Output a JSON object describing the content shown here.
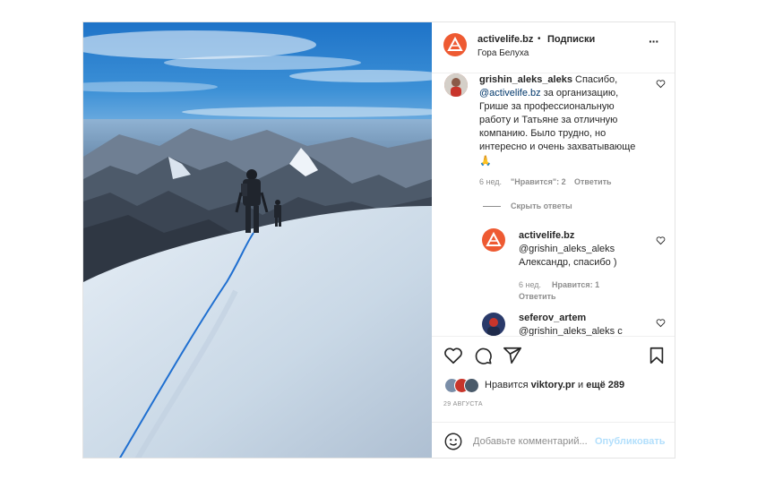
{
  "post": {
    "author": "activelife.bz",
    "dot": "•",
    "follow_label": "Подписки",
    "location": "Гора Белуха",
    "more_label": "···"
  },
  "comments": [
    {
      "user": "grishin_aleks_aleks",
      "text_part1": "Спасибо,",
      "mention": "@activelife.bz",
      "text_part2_line1": " за организацию,",
      "text_lines": [
        "Грише за профессиональную",
        "работу и Татьяне за отличную",
        "компанию. Было трудно, но",
        "интересно и очень захватывающе"
      ],
      "emoji": "🙏",
      "time": "6 нед.",
      "likes": "\"Нравится\": 2",
      "reply_label": "Ответить"
    }
  ],
  "hide_replies_label": "Скрыть ответы",
  "replies": [
    {
      "user": "activelife.bz",
      "mention": "@grishin_aleks_aleks",
      "text": "Александр, спасибо )",
      "time": "6 нед.",
      "likes": "Нравится: 1",
      "reply_label": "Ответить"
    },
    {
      "user": "seferov_artem",
      "mention": "@grishin_aleks_aleks с"
    }
  ],
  "likes_line": {
    "prefix": "Нравится",
    "user": "viktory.pr",
    "conj": "и",
    "others": "ещё 289"
  },
  "date": "29 АВГУСТА",
  "composer": {
    "placeholder": "Добавьте комментарий...",
    "publish_label": "Опубликовать"
  },
  "colors": {
    "brand": "#ee5a32",
    "link": "#00376b",
    "publish_disabled": "#b2dffc"
  },
  "icons": [
    "heart-icon",
    "comment-icon",
    "share-icon",
    "bookmark-icon",
    "more-icon",
    "smiley-icon",
    "brand-logo-icon"
  ]
}
